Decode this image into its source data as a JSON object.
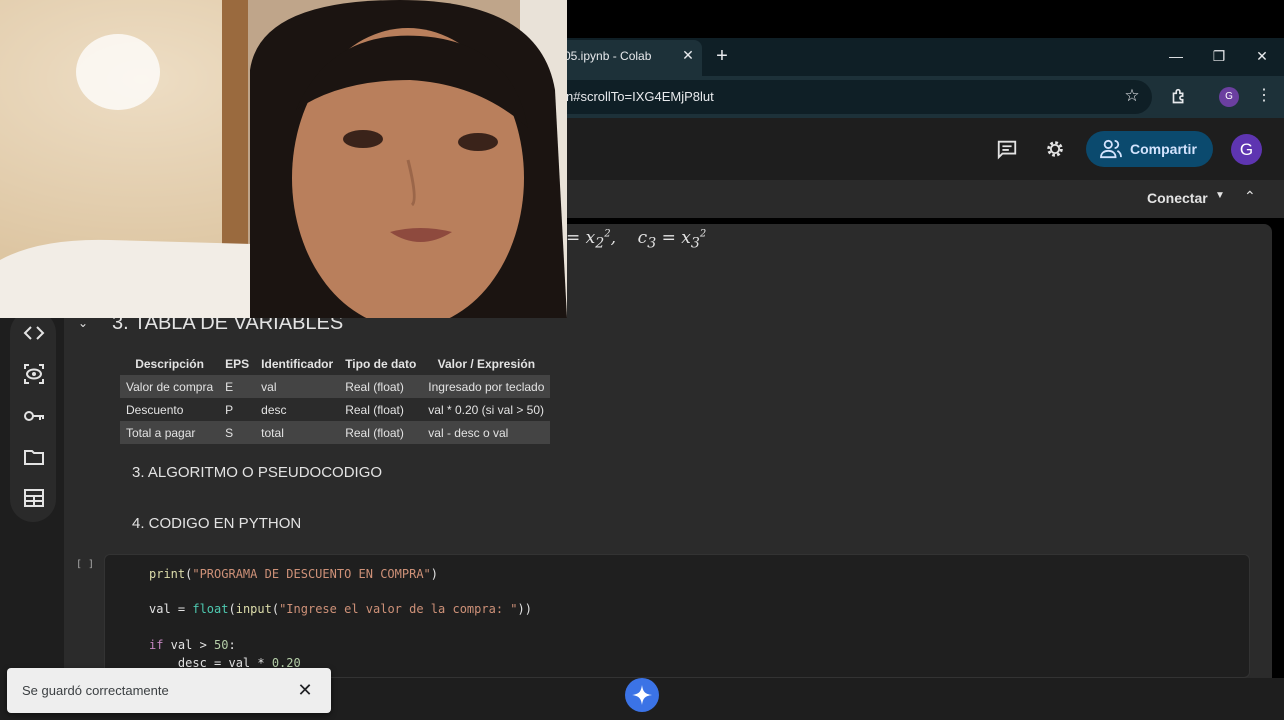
{
  "browser": {
    "tab_title": "05.ipynb - Colab",
    "tab_close": "✕",
    "new_tab": "+",
    "url": "n#scrollTo=IXG4EMjP8lut",
    "profile_initial": "G",
    "window_controls": {
      "minimize": "—",
      "restore": "❐",
      "close": "✕"
    }
  },
  "header": {
    "share_label": "Compartir",
    "avatar_initial": "G"
  },
  "toolbar": {
    "connect_label": "Conectar",
    "connect_caret": "▼",
    "collapse_caret": "⌃"
  },
  "notebook": {
    "section_heading": "3. TABLA DE VARIABLES",
    "table": {
      "headers": [
        "Descripción",
        "EPS",
        "Identificador",
        "Tipo de dato",
        "Valor / Expresión"
      ],
      "rows": [
        [
          "Valor de compra",
          "E",
          "val",
          "Real (float)",
          "Ingresado por teclado"
        ],
        [
          "Descuento",
          "P",
          "desc",
          "Real (float)",
          "val * 0.20 (si val > 50)"
        ],
        [
          "Total a pagar",
          "S",
          "total",
          "Real (float)",
          "val - desc o val"
        ]
      ]
    },
    "heading_algorithm": "3. ALGORITMO O PSEUDOCODIGO",
    "heading_code": "4. CODIGO EN PYTHON",
    "cell_run_marker": "[ ]",
    "code": {
      "print_fn": "print",
      "print_arg": "\"PROGRAMA DE DESCUENTO EN COMPRA\"",
      "val_assign": "val = ",
      "float_fn": "float",
      "input_fn": "input",
      "input_arg": "\"Ingrese el valor de la compra: \"",
      "if_kw": "if",
      "if_cond": " val > ",
      "if_num": "50",
      "if_colon": ":",
      "desc_line": "    desc = val * ",
      "desc_num": "0.20"
    }
  },
  "toast": {
    "message": "Se guardó correctamente",
    "close": "✕"
  },
  "colors": {
    "share_button_bg": "#0b4a6e",
    "avatar_bg": "#5e35b1",
    "gemini_button": "#3b73e6",
    "notebook_bg": "#2b2b2b"
  }
}
